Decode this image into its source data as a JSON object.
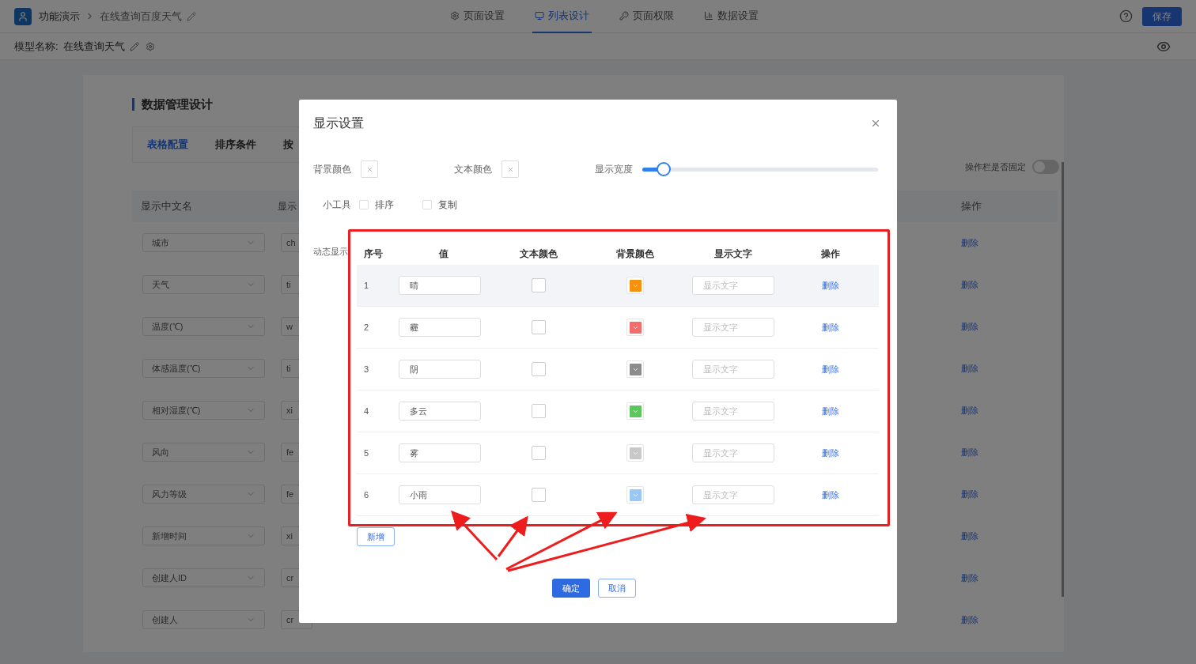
{
  "header": {
    "app_title": "功能演示",
    "breadcrumb": "在线查询百度天气",
    "tabs": [
      {
        "label": "页面设置",
        "selected": false
      },
      {
        "label": "列表设计",
        "selected": true
      },
      {
        "label": "页面权限",
        "selected": false
      },
      {
        "label": "数据设置",
        "selected": false
      }
    ],
    "save": "保存"
  },
  "model_bar": {
    "label": "模型名称:",
    "name": "在线查询天气"
  },
  "designer": {
    "title": "数据管理设计",
    "tabs": [
      {
        "label": "表格配置",
        "selected": true
      },
      {
        "label": "排序条件",
        "selected": false
      },
      {
        "label": "按",
        "selected": false
      }
    ],
    "fixed_toggle": {
      "label": "操作栏是否固定",
      "on": false
    },
    "columns": [
      "显示中文名",
      "显示",
      "操作"
    ],
    "rows": [
      {
        "name": "城市",
        "field": "ch",
        "action": "删除"
      },
      {
        "name": "天气",
        "field": "ti",
        "action": "删除"
      },
      {
        "name": "温度(℃)",
        "field": "w",
        "action": "删除"
      },
      {
        "name": "体感温度(℃)",
        "field": "ti",
        "action": "删除"
      },
      {
        "name": "相对湿度(℃)",
        "field": "xi",
        "action": "删除"
      },
      {
        "name": "风向",
        "field": "fe",
        "action": "删除"
      },
      {
        "name": "风力等级",
        "field": "fe",
        "action": "删除"
      },
      {
        "name": "新增时间",
        "field": "xi",
        "action": "删除"
      },
      {
        "name": "创建人ID",
        "field": "cr",
        "action": "删除"
      },
      {
        "name": "创建人",
        "field": "cr",
        "action": "删除"
      }
    ]
  },
  "dialog": {
    "title": "显示设置",
    "bg_color_label": "背景颜色",
    "text_color_label": "文本颜色",
    "width_label": "显示宽度",
    "width": {
      "level": 0.09
    },
    "tools": {
      "label": "小工具",
      "options": [
        {
          "label": "排序",
          "checked": false
        },
        {
          "label": "复制",
          "checked": false
        }
      ]
    },
    "dynamic_label": "动态显示",
    "table": {
      "columns": [
        "序号",
        "值",
        "文本颜色",
        "背景颜色",
        "显示文字",
        "操作"
      ],
      "rows": [
        {
          "index": "1",
          "value": "晴",
          "color": "#f7900f",
          "placeholder": "显示文字",
          "action": "删除",
          "hovered": true
        },
        {
          "index": "2",
          "value": "霾",
          "color": "#f56c6c",
          "placeholder": "显示文字",
          "action": "删除",
          "hovered": false
        },
        {
          "index": "3",
          "value": "阴",
          "color": "#8c8c8c",
          "placeholder": "显示文字",
          "action": "删除",
          "hovered": false
        },
        {
          "index": "4",
          "value": "多云",
          "color": "#5cc85c",
          "placeholder": "显示文字",
          "action": "删除",
          "hovered": false
        },
        {
          "index": "5",
          "value": "雾",
          "color": "#c8c8c8",
          "placeholder": "显示文字",
          "action": "删除",
          "hovered": false
        },
        {
          "index": "6",
          "value": "小雨",
          "color": "#99c8f5",
          "placeholder": "显示文字",
          "action": "删除",
          "hovered": false
        }
      ]
    },
    "add": "新增",
    "ok": "确定",
    "cancel": "取消"
  }
}
